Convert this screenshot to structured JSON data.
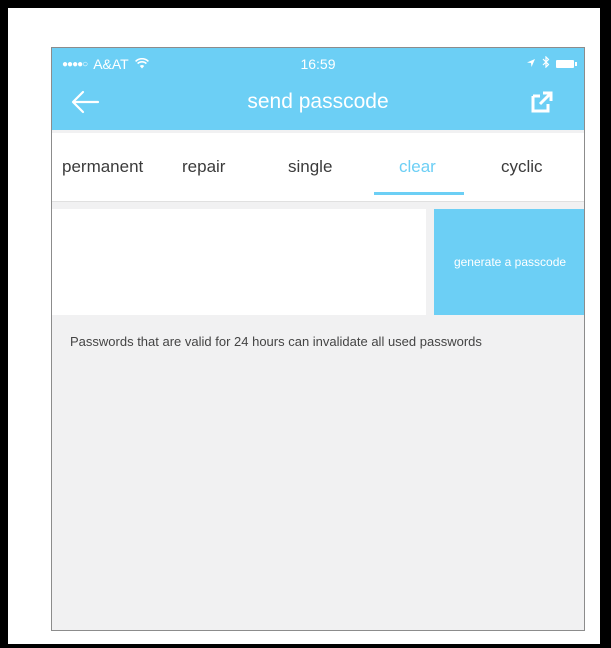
{
  "status_bar": {
    "signal": "●●●●○",
    "carrier": "A&AT",
    "time": "16:59"
  },
  "header": {
    "title": "send passcode",
    "back_icon": "arrow-left-icon",
    "share_icon": "share-external-icon"
  },
  "tabs": [
    {
      "label": "permanent",
      "active": false
    },
    {
      "label": "repair",
      "active": false
    },
    {
      "label": "single",
      "active": false
    },
    {
      "label": "clear",
      "active": true
    },
    {
      "label": "cyclic",
      "active": false
    }
  ],
  "passcode": {
    "value": "",
    "button_label": "generate a passcode"
  },
  "notice": "Passwords that are valid for 24 hours can invalidate all used passwords",
  "colors": {
    "accent": "#6ccff5",
    "background": "#f1f1f2"
  }
}
